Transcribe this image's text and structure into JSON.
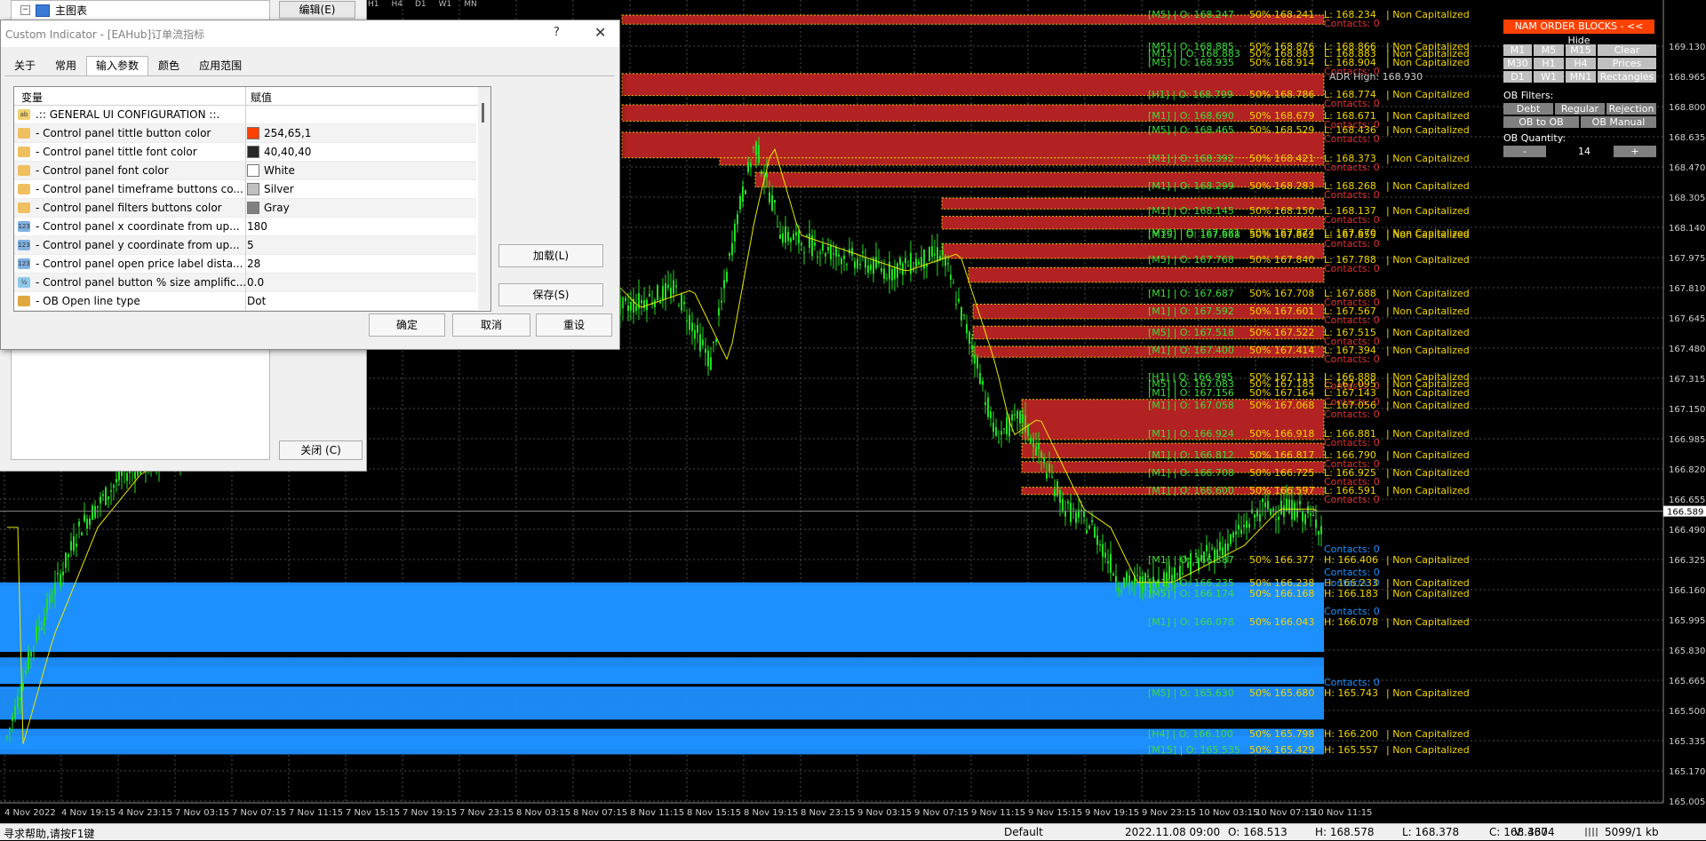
{
  "background_panel": {
    "tree_label": "主图表",
    "edit_button": "编辑(E)",
    "close_button": "关闭 (C)",
    "timeframes": [
      "H1",
      "H4",
      "D1",
      "W1",
      "MN"
    ]
  },
  "dialog": {
    "title": "Custom Indicator - [EAHub]订单流指标",
    "help": "?",
    "close": "✕",
    "tabs": [
      "关于",
      "常用",
      "输入参数",
      "颜色",
      "应用范围"
    ],
    "active_tab": 2,
    "grid": {
      "col_variable": "变量",
      "col_value": "赋值",
      "rows": [
        {
          "icon": "ab",
          "name": ".:: GENERAL UI CONFIGURATION ::.",
          "value": "",
          "swatch": ""
        },
        {
          "icon": "color",
          "name": "- Control panel tittle button color",
          "value": "254,65,1",
          "swatch": "#fe4101"
        },
        {
          "icon": "color",
          "name": "- Control panel tittle font color",
          "value": "40,40,40",
          "swatch": "#282828"
        },
        {
          "icon": "color",
          "name": "- Control panel font color",
          "value": "White",
          "swatch": "#ffffff"
        },
        {
          "icon": "color",
          "name": "- Control panel timeframe buttons co...",
          "value": "Silver",
          "swatch": "#c0c0c0"
        },
        {
          "icon": "color",
          "name": "- Control panel filters buttons color",
          "value": "Gray",
          "swatch": "#808080"
        },
        {
          "icon": "123",
          "name": "- Control panel x coordinate from up...",
          "value": "180",
          "swatch": ""
        },
        {
          "icon": "123",
          "name": "- Control panel y coordinate from up...",
          "value": "5",
          "swatch": ""
        },
        {
          "icon": "123",
          "name": "- Control panel open price label dista...",
          "value": "28",
          "swatch": ""
        },
        {
          "icon": "v2",
          "name": "- Control panel button % size amplific...",
          "value": "0.0",
          "swatch": ""
        },
        {
          "icon": "list",
          "name": "- OB Open line type",
          "value": "Dot",
          "swatch": ""
        }
      ]
    },
    "load_button": "加载(L)",
    "save_button": "保存(S)",
    "ok_button": "确定",
    "cancel_button": "取消",
    "reset_button": "重设"
  },
  "control_panel": {
    "title": "NAM ORDER BLOCKS - << Hide",
    "tf_row1": [
      "M1",
      "M5",
      "M15"
    ],
    "clear": "Clear",
    "tf_row2": [
      "M30",
      "H1",
      "H4"
    ],
    "prices": "Prices",
    "tf_row3": [
      "D1",
      "W1",
      "MN1"
    ],
    "rectangles": "Rectangles",
    "ob_filters_label": "OB Filters:",
    "filters_row1": [
      "Debt",
      "Regular",
      "Rejection"
    ],
    "filters_row2": [
      "OB to OB",
      "OB Manual"
    ],
    "ob_quantity_label": "OB Quantity:",
    "qty_minus": "-",
    "qty_value": "14",
    "qty_plus": "+"
  },
  "chart": {
    "price_axis": [
      "169.130",
      "168.965",
      "168.800",
      "168.635",
      "168.470",
      "168.305",
      "168.140",
      "167.975",
      "167.810",
      "167.645",
      "167.480",
      "167.315",
      "167.150",
      "166.985",
      "166.820",
      "166.655",
      "166.490",
      "166.325",
      "166.160",
      "165.995",
      "165.830",
      "165.665",
      "165.500",
      "165.335",
      "165.170",
      "165.005"
    ],
    "current_price": "166.589",
    "time_axis": [
      "4 Nov 2022",
      "4 Nov 19:15",
      "4 Nov 23:15",
      "7 Nov 03:15",
      "7 Nov 07:15",
      "7 Nov 11:15",
      "7 Nov 15:15",
      "7 Nov 19:15",
      "7 Nov 23:15",
      "8 Nov 03:15",
      "8 Nov 07:15",
      "8 Nov 11:15",
      "8 Nov 15:15",
      "8 Nov 19:15",
      "8 Nov 23:15",
      "9 Nov 03:15",
      "9 Nov 07:15",
      "9 Nov 11:15",
      "9 Nov 15:15",
      "9 Nov 19:15",
      "9 Nov 23:15",
      "10 Nov 03:15",
      "10 Nov 07:15",
      "10 Nov 11:15"
    ],
    "adr_high": "ADR High: 168.930",
    "bearish_obs": [
      {
        "tf": "[M5]",
        "o": "O: 168.247",
        "m": "50% 168.241",
        "l": "L: 168.234",
        "contacts": "Contacts: 0"
      },
      {
        "tf": "[M5]",
        "o": "O: 168.885",
        "m": "50% 168.876",
        "l": "L: 168.866",
        "contacts": ""
      },
      {
        "tf": "[M15]",
        "o": "O: 168.883",
        "m": "50% 168.883",
        "l": "L: 168.883",
        "contacts": ""
      },
      {
        "tf": "[M5]",
        "o": "O: 168.935",
        "m": "50% 168.914",
        "l": "L: 168.904",
        "contacts": "Contacts: 0"
      },
      {
        "tf": "[H1]",
        "o": "O: 168.799",
        "m": "50% 168.786",
        "l": "L: 168.774",
        "contacts": "Contacts: 0"
      },
      {
        "tf": "[M1]",
        "o": "O: 168.690",
        "m": "50% 168.679",
        "l": "L: 168.671",
        "contacts": "Contacts: 0"
      },
      {
        "tf": "[M5]",
        "o": "O: 168.465",
        "m": "50% 168.529",
        "l": "L: 168.436",
        "contacts": "Contacts: 0"
      },
      {
        "tf": "[M1]",
        "o": "O: 168.392",
        "m": "50% 168.421",
        "l": "L: 168.373",
        "contacts": "Contacts: 0"
      },
      {
        "tf": "[M1]",
        "o": "O: 168.299",
        "m": "50% 168.283",
        "l": "L: 168.268",
        "contacts": "Contacts: 0"
      },
      {
        "tf": "[M1]",
        "o": "O: 168.145",
        "m": "50% 168.150",
        "l": "L: 168.137",
        "contacts": "Contacts: 0"
      },
      {
        "tf": "[M30]",
        "o": "O: 167.681",
        "m": "50% 167.874",
        "l": "L: 167.670",
        "contacts": ""
      },
      {
        "tf": "[M15]",
        "o": "O: 167.868",
        "m": "50% 167.862",
        "l": "L: 167.855",
        "contacts": "Contacts: 0"
      },
      {
        "tf": "[M5]",
        "o": "O: 167.768",
        "m": "50% 167.840",
        "l": "L: 167.788",
        "contacts": "Contacts: 0"
      },
      {
        "tf": "[M1]",
        "o": "O: 167.687",
        "m": "50% 167.708",
        "l": "L: 167.688",
        "contacts": "Contacts: 0"
      },
      {
        "tf": "[M1]",
        "o": "O: 167.592",
        "m": "50% 167.601",
        "l": "L: 167.567",
        "contacts": "Contacts: 0"
      },
      {
        "tf": "[M5]",
        "o": "O: 167.518",
        "m": "50% 167.522",
        "l": "L: 167.515",
        "contacts": "Contacts: 0"
      },
      {
        "tf": "[M1]",
        "o": "O: 167.400",
        "m": "50% 167.414",
        "l": "L: 167.394",
        "contacts": "Contacts: 0"
      },
      {
        "tf": "[H1]",
        "o": "O: 166.995",
        "m": "50% 167.113",
        "l": "L: 166.888",
        "contacts": "Contacts: 0"
      },
      {
        "tf": "[M5]",
        "o": "O: 167.083",
        "m": "50% 167.185",
        "l": "L: 167.095",
        "contacts": ""
      },
      {
        "tf": "[M1]",
        "o": "O: 167.156",
        "m": "50% 167.164",
        "l": "L: 167.143",
        "contacts": "Contacts: 0"
      },
      {
        "tf": "[M1]",
        "o": "O: 167.058",
        "m": "50% 167.068",
        "l": "L: 167.056",
        "contacts": "Contacts: 0"
      },
      {
        "tf": "[M1]",
        "o": "O: 166.924",
        "m": "50% 166.918",
        "l": "L: 166.881",
        "contacts": "Contacts: 0"
      },
      {
        "tf": "[M1]",
        "o": "O: 166.812",
        "m": "50% 166.817",
        "l": "L: 166.790",
        "contacts": "Contacts: 0"
      },
      {
        "tf": "[M1]",
        "o": "O: 166.708",
        "m": "50% 166.725",
        "l": "L: 166.925",
        "contacts": "Contacts: 0"
      },
      {
        "tf": "[M1]",
        "o": "O: 166.600",
        "m": "50% 166.597",
        "l": "L: 166.591",
        "contacts": "Contacts: 0"
      }
    ],
    "bullish_obs": [
      {
        "tf": "[M1]",
        "o": "O: 166.387",
        "m": "50% 166.377",
        "l": "H: 166.406",
        "contacts": "Contacts: 0"
      },
      {
        "tf": "[M1]",
        "o": "O: 166.235",
        "m": "50% 166.238",
        "l": "H: 166.233",
        "contacts": "Contacts: 0"
      },
      {
        "tf": "[M5]",
        "o": "O: 166.174",
        "m": "50% 166.168",
        "l": "H: 166.183",
        "contacts": "Contacts: 0"
      },
      {
        "tf": "[M1]",
        "o": "O: 166.078",
        "m": "50% 166.043",
        "l": "H: 166.078",
        "contacts": "Contacts: 0"
      },
      {
        "tf": "[M5]",
        "o": "O: 165.630",
        "m": "50% 165.680",
        "l": "H: 165.743",
        "contacts": "Contacts: 0"
      },
      {
        "tf": "[H4]",
        "o": "O: 166.100",
        "m": "50% 165.798",
        "l": "H: 166.200",
        "contacts": ""
      },
      {
        "tf": "[M15]",
        "o": "O: 165.535",
        "m": "50% 165.429",
        "l": "H: 165.557",
        "contacts": ""
      }
    ],
    "non_capitalized": "Non Capitalized",
    "colors": {
      "bear": "#b22222",
      "bull": "#1e90ff",
      "candle": "#22dd22",
      "ma": "#e8e800",
      "grid": "#4a4a4a"
    }
  },
  "status_bar": {
    "help": "寻求帮助,请按F1键",
    "profile": "Default",
    "datetime": "2022.11.08 09:00",
    "open": "O: 168.513",
    "high": "H: 168.578",
    "low": "L: 168.378",
    "close": "C: 168.460",
    "volume": "V: 3374",
    "traffic": "5099/1 kb"
  }
}
